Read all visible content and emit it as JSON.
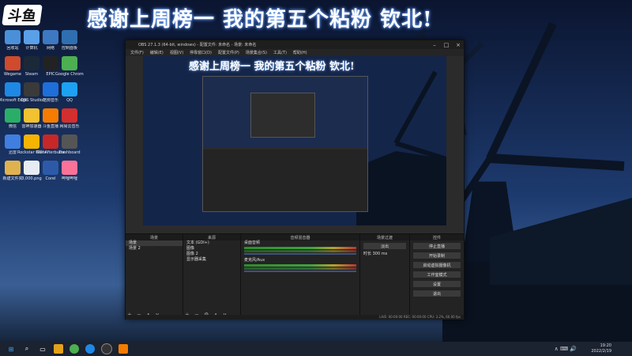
{
  "stream": {
    "logo_text": "斗鱼",
    "title": "感谢上周榜一 我的第五个粘粉 钦北!"
  },
  "desktop": {
    "icons": [
      {
        "label": "回收站",
        "color": "#4a90d9"
      },
      {
        "label": "计算机",
        "color": "#5aa0e8"
      },
      {
        "label": "网络",
        "color": "#3d78c2"
      },
      {
        "label": "控制面板",
        "color": "#2f6fb0"
      },
      {
        "label": "Wegame",
        "color": "#d04a2c"
      },
      {
        "label": "Steam",
        "color": "#1b2838"
      },
      {
        "label": "EPIC",
        "color": "#222222"
      },
      {
        "label": "Google Chrome",
        "color": "#4caf50"
      },
      {
        "label": "Microsoft Edge",
        "color": "#1e88e5"
      },
      {
        "label": "OBS Studio",
        "color": "#3a3a3a"
      },
      {
        "label": "酷狗音乐",
        "color": "#1e6fd9"
      },
      {
        "label": "QQ",
        "color": "#1da1f2"
      },
      {
        "label": "微信",
        "color": "#2aae67"
      },
      {
        "label": "雷神加速器",
        "color": "#f2c230"
      },
      {
        "label": "斗鱼直播",
        "color": "#f57c00"
      },
      {
        "label": "网易云音乐",
        "color": "#d32f2f"
      },
      {
        "label": "迅雷",
        "color": "#3f7fe0"
      },
      {
        "label": "Rockstar Games",
        "color": "#f5b400"
      },
      {
        "label": "MSI Afterburner",
        "color": "#c62828"
      },
      {
        "label": "Dashboard",
        "color": "#555555"
      },
      {
        "label": "新建文件夹",
        "color": "#e0b24f"
      },
      {
        "label": "3,000.png",
        "color": "#e7ecf3"
      },
      {
        "label": "Corel",
        "color": "#2d5aa8"
      },
      {
        "label": "哔哩哔哩",
        "color": "#fb7299"
      }
    ]
  },
  "obs": {
    "title": "OBS 27.1.3 (64-bit, windows) - 配置文件: 未命名 - 场景: 未命名",
    "menu": [
      "文件(F)",
      "编辑(E)",
      "视图(V)",
      "停靠窗口(D)",
      "配置文件(P)",
      "场景集合(S)",
      "工具(T)",
      "帮助(H)"
    ],
    "preview_title": "感谢上周榜一 我的第五个粘粉 钦北!",
    "docks": {
      "scenes": {
        "header": "场景",
        "items": [
          "场景",
          "场景 2"
        ]
      },
      "sources": {
        "header": "来源",
        "items": [
          "文本 (GDI+)",
          "图像",
          "图像 2",
          "显示器采集"
        ]
      },
      "mixer": {
        "header": "音频混音器",
        "tracks": [
          {
            "name": "桌面音频",
            "db": "0.0 dB"
          },
          {
            "name": "麦克风/Aux",
            "db": "0.0 dB"
          }
        ]
      },
      "transitions": {
        "header": "场景过渡",
        "type": "淡出",
        "duration_label": "时长",
        "duration": "300 ms"
      },
      "controls": {
        "header": "控件",
        "buttons": [
          "停止直播",
          "开始录制",
          "启动虚拟摄像机",
          "工作室模式",
          "设置",
          "退出"
        ]
      }
    },
    "statusbar": "LIVE: 00:00:00   REC: 00:00:00   CPU: 3.2%, 60.00 fps"
  },
  "taskbar": {
    "time": "19:20",
    "date": "2022/2/19"
  },
  "colors": {
    "sky_top": "#0b1530",
    "sky_mid": "#1d3a6e",
    "accent_glow": "#7fb2ff",
    "obs_bg": "#2b2b2b"
  }
}
